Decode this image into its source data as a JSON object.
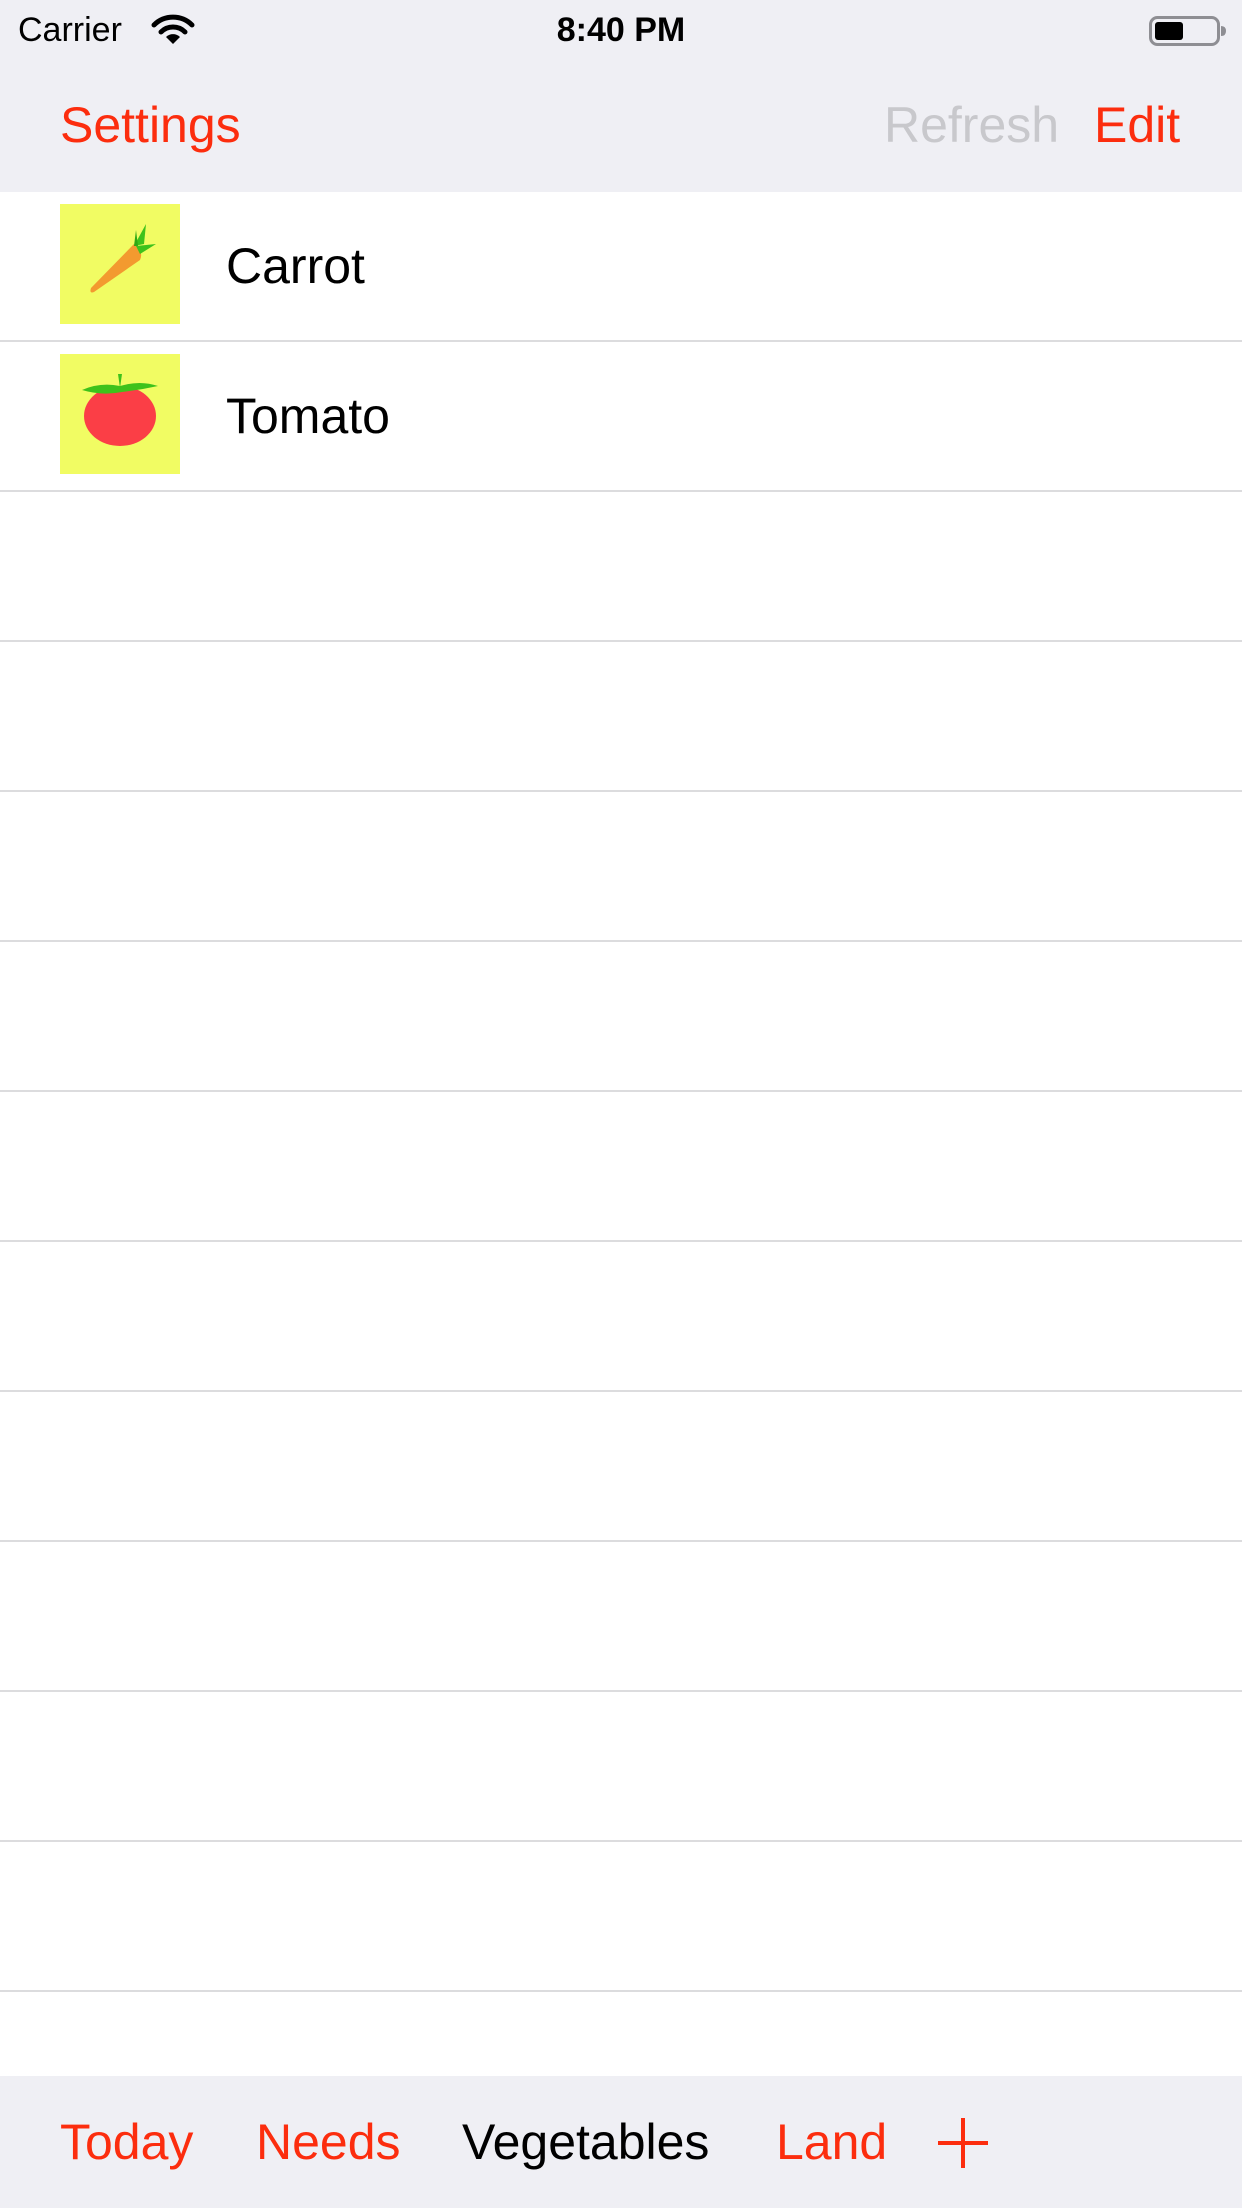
{
  "status_bar": {
    "carrier": "Carrier",
    "time": "8:40 PM",
    "icons": [
      "wifi-icon",
      "battery-icon"
    ]
  },
  "nav_bar": {
    "left_button": "Settings",
    "refresh_button": "Refresh",
    "edit_button": "Edit",
    "refresh_enabled": false
  },
  "list": {
    "items": [
      {
        "label": "Carrot",
        "icon": "carrot-icon"
      },
      {
        "label": "Tomato",
        "icon": "tomato-icon"
      }
    ]
  },
  "tab_bar": {
    "tabs": [
      {
        "label": "Today",
        "selected": false
      },
      {
        "label": "Needs",
        "selected": false
      },
      {
        "label": "Vegetables",
        "selected": true
      },
      {
        "label": "Land",
        "selected": false
      }
    ],
    "add_icon": "plus-icon"
  },
  "colors": {
    "accent": "#fc2d0e",
    "disabled": "#c8c8cc",
    "bar_background": "#efeff4",
    "thumbnail_background": "#f1fc63",
    "separator": "#dcdcde"
  }
}
